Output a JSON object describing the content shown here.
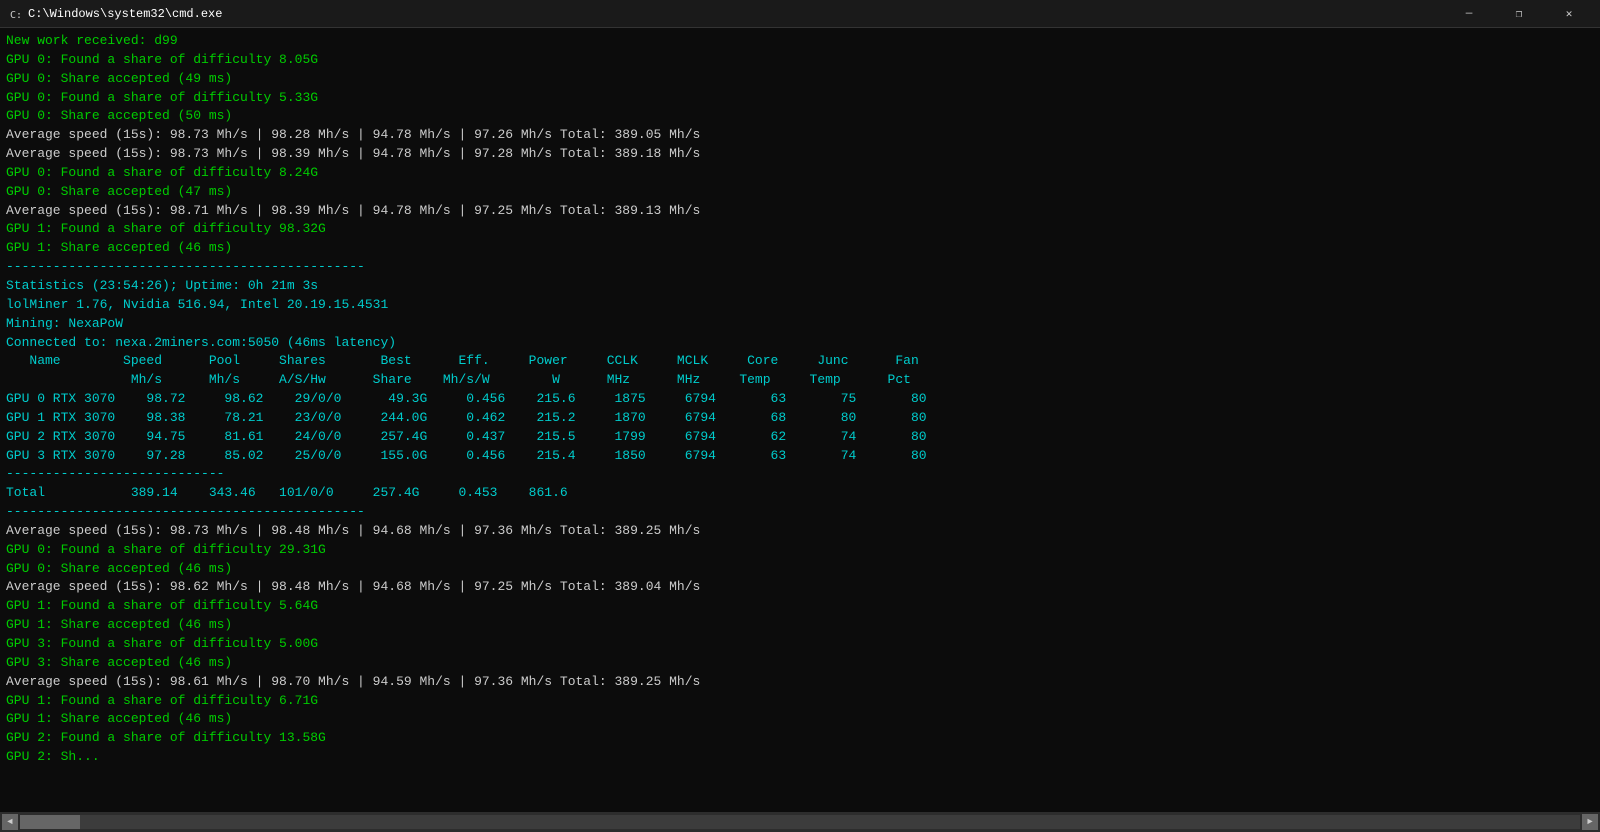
{
  "titlebar": {
    "icon": "cmd-icon",
    "title": "C:\\Windows\\system32\\cmd.exe",
    "minimize_label": "—",
    "restore_label": "❐",
    "close_label": "✕"
  },
  "terminal": {
    "lines": [
      {
        "text": "New work received: d99",
        "color": "green"
      },
      {
        "text": "GPU 0: Found a share of difficulty 8.05G",
        "color": "green"
      },
      {
        "text": "GPU 0: Share accepted (49 ms)",
        "color": "green"
      },
      {
        "text": "GPU 0: Found a share of difficulty 5.33G",
        "color": "green"
      },
      {
        "text": "GPU 0: Share accepted (50 ms)",
        "color": "green"
      },
      {
        "text": "Average speed (15s): 98.73 Mh/s | 98.28 Mh/s | 94.78 Mh/s | 97.26 Mh/s Total: 389.05 Mh/s",
        "color": "white"
      },
      {
        "text": "Average speed (15s): 98.73 Mh/s | 98.39 Mh/s | 94.78 Mh/s | 97.28 Mh/s Total: 389.18 Mh/s",
        "color": "white"
      },
      {
        "text": "GPU 0: Found a share of difficulty 8.24G",
        "color": "green"
      },
      {
        "text": "GPU 0: Share accepted (47 ms)",
        "color": "green"
      },
      {
        "text": "Average speed (15s): 98.71 Mh/s | 98.39 Mh/s | 94.78 Mh/s | 97.25 Mh/s Total: 389.13 Mh/s",
        "color": "white"
      },
      {
        "text": "GPU 1: Found a share of difficulty 98.32G",
        "color": "green"
      },
      {
        "text": "GPU 1: Share accepted (46 ms)",
        "color": "green"
      },
      {
        "text": "----------------------------------------------",
        "color": "cyan"
      },
      {
        "text": "Statistics (23:54:26); Uptime: 0h 21m 3s",
        "color": "cyan"
      },
      {
        "text": "lolMiner 1.76, Nvidia 516.94, Intel 20.19.15.4531",
        "color": "cyan"
      },
      {
        "text": "Mining: NexaPoW",
        "color": "cyan"
      },
      {
        "text": "Connected to: nexa.2miners.com:5050 (46ms latency)",
        "color": "cyan"
      },
      {
        "text": "",
        "color": "white"
      },
      {
        "text": "   Name        Speed      Pool     Shares       Best      Eff.     Power     CCLK     MCLK     Core     Junc      Fan",
        "color": "cyan",
        "is_header": true
      },
      {
        "text": "                Mh/s      Mh/s     A/S/Hw      Share    Mh/s/W        W      MHz      MHz     Temp     Temp      Pct",
        "color": "cyan",
        "is_header": true
      },
      {
        "text": "GPU 0 RTX 3070    98.72     98.62    29/0/0      49.3G     0.456    215.6     1875     6794       63       75       80",
        "color": "cyan",
        "is_gpu": true
      },
      {
        "text": "GPU 1 RTX 3070    98.38     78.21    23/0/0     244.0G     0.462    215.2     1870     6794       68       80       80",
        "color": "cyan",
        "is_gpu": true
      },
      {
        "text": "GPU 2 RTX 3070    94.75     81.61    24/0/0     257.4G     0.437    215.5     1799     6794       62       74       80",
        "color": "cyan",
        "is_gpu": true
      },
      {
        "text": "GPU 3 RTX 3070    97.28     85.02    25/0/0     155.0G     0.456    215.4     1850     6794       63       74       80",
        "color": "cyan",
        "is_gpu": true
      },
      {
        "text": "----------------------------",
        "color": "cyan"
      },
      {
        "text": "Total           389.14    343.46   101/0/0     257.4G     0.453    861.6",
        "color": "cyan",
        "is_total": true
      },
      {
        "text": "----------------------------------------------",
        "color": "cyan"
      },
      {
        "text": "Average speed (15s): 98.73 Mh/s | 98.48 Mh/s | 94.68 Mh/s | 97.36 Mh/s Total: 389.25 Mh/s",
        "color": "white"
      },
      {
        "text": "GPU 0: Found a share of difficulty 29.31G",
        "color": "green"
      },
      {
        "text": "GPU 0: Share accepted (46 ms)",
        "color": "green"
      },
      {
        "text": "Average speed (15s): 98.62 Mh/s | 98.48 Mh/s | 94.68 Mh/s | 97.25 Mh/s Total: 389.04 Mh/s",
        "color": "white"
      },
      {
        "text": "GPU 1: Found a share of difficulty 5.64G",
        "color": "green"
      },
      {
        "text": "GPU 1: Share accepted (46 ms)",
        "color": "green"
      },
      {
        "text": "GPU 3: Found a share of difficulty 5.00G",
        "color": "green"
      },
      {
        "text": "GPU 3: Share accepted (46 ms)",
        "color": "green"
      },
      {
        "text": "Average speed (15s): 98.61 Mh/s | 98.70 Mh/s | 94.59 Mh/s | 97.36 Mh/s Total: 389.25 Mh/s",
        "color": "white"
      },
      {
        "text": "GPU 1: Found a share of difficulty 6.71G",
        "color": "green"
      },
      {
        "text": "GPU 1: Share accepted (46 ms)",
        "color": "green"
      },
      {
        "text": "GPU 2: Found a share of difficulty 13.58G",
        "color": "green"
      },
      {
        "text": "GPU 2: Sh...",
        "color": "green"
      }
    ]
  },
  "scrollbar": {
    "left_arrow": "◄",
    "right_arrow": "►"
  }
}
